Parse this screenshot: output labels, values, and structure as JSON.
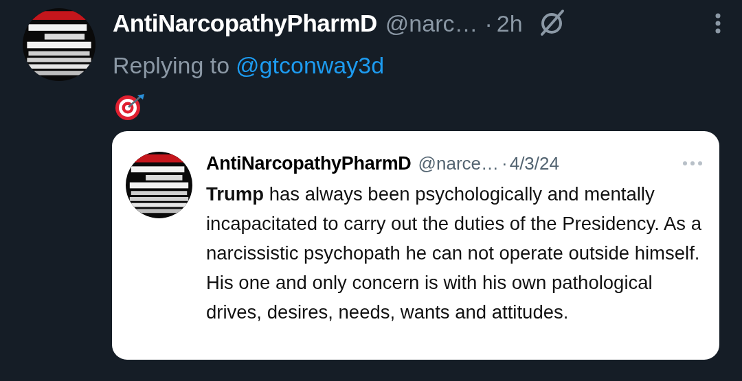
{
  "post": {
    "author": "AntiNarcopathyPharmD",
    "handle": "@narc…",
    "separator": "·",
    "time": "2h",
    "replying_prefix": "Replying to",
    "replying_handle": "@gtconway3d"
  },
  "quote": {
    "author": "AntiNarcopathyPharmD",
    "handle": "@narce…",
    "separator": "·",
    "date": "4/3/24",
    "text": "**Trump** has always been psychologically and mentally incapacitated to carry out the duties of the Presidency. As a narcissistic psychopath he can not operate outside himself. His one and only concern is with his own pathological drives, desires, needs, wants and attitudes."
  }
}
